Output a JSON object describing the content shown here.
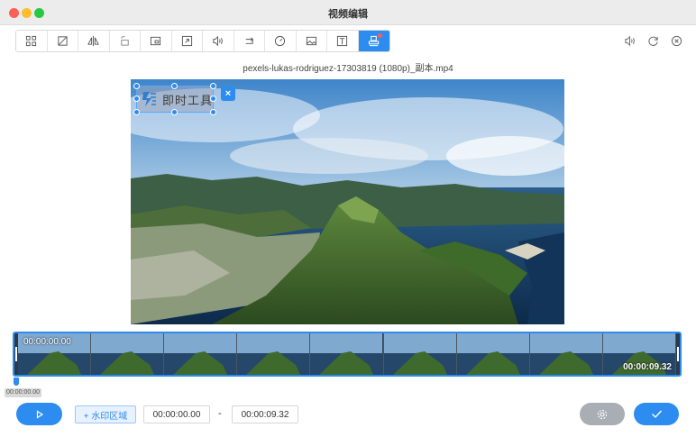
{
  "window": {
    "title": "视频编辑"
  },
  "toolbar": {
    "tools": [
      {
        "icon": "crop-frame-icon"
      },
      {
        "icon": "crop-icon"
      },
      {
        "icon": "flip-icon"
      },
      {
        "icon": "rotate-icon"
      },
      {
        "icon": "pip-icon"
      },
      {
        "icon": "resize-icon"
      },
      {
        "icon": "volume-icon"
      },
      {
        "icon": "loop-icon"
      },
      {
        "icon": "speed-icon"
      },
      {
        "icon": "image-icon"
      },
      {
        "icon": "text-icon"
      },
      {
        "icon": "watermark-stamp-icon",
        "active": true
      }
    ],
    "right": [
      {
        "icon": "audio-icon"
      },
      {
        "icon": "refresh-icon"
      },
      {
        "icon": "close-circle-icon"
      }
    ]
  },
  "file": {
    "name": "pexels-lukas-rodriguez-17303819 (1080p)_副本.mp4"
  },
  "watermark": {
    "text": "即时工具"
  },
  "timeline": {
    "start_time": "00:00:00.00",
    "end_time": "00:00:09.32",
    "playhead_time": "00:00:00.00"
  },
  "controls": {
    "watermark_area_label": "+ 水印区域",
    "start_value": "00:00:00.00",
    "separator": "-",
    "end_value": "00:00:09.32"
  },
  "colors": {
    "accent": "#2d8cf0",
    "settings_button": "#a9aeb5"
  }
}
